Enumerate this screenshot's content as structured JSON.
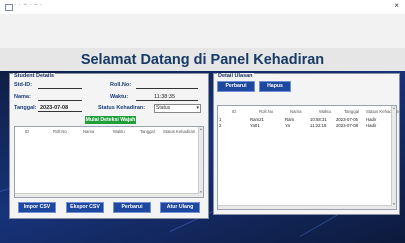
{
  "window": {
    "title": "· · − ∙ − ∙",
    "close_glyph": "×"
  },
  "banner": {
    "title": "Selamat Datang di Panel Kehadiran"
  },
  "student_panel": {
    "title": "Student Details",
    "std_id_label": "Std-ID:",
    "roll_no_label": "Roll.No:",
    "nama_label": "Nama:",
    "waktu_label": "Waktu:",
    "waktu_value": "11:38:35",
    "tanggal_label": "Tanggal:",
    "tanggal_value": "2023-07-08",
    "status_label": "Status Kehadiran:",
    "status_value": "Status",
    "detect_button": "Mulai Deteksi Wajah",
    "table_headers": [
      "ID",
      "Roll.No",
      "Nama",
      "Waktu",
      "Tanggal",
      "Status Kehadiran"
    ],
    "import_button": "Impor CSV",
    "export_button": "Ekspor CSV",
    "update_button": "Perbarui",
    "reset_button": "Atur Ulang"
  },
  "detail_panel": {
    "title": "Detail Ulasan",
    "update_button": "Perbarui",
    "delete_button": "Hapus",
    "table_headers": [
      "ID",
      "Roll.No",
      "Nama",
      "Waktu",
      "Tanggal",
      "Status Kehadiran"
    ],
    "rows": [
      [
        "1",
        "Ram21",
        "Ram",
        "10:58:31",
        "2023-07-05",
        "Hadir"
      ],
      [
        "2",
        "Ya01",
        "Ya",
        "11:22:16",
        "2023-07-08",
        "Hadir"
      ]
    ]
  }
}
